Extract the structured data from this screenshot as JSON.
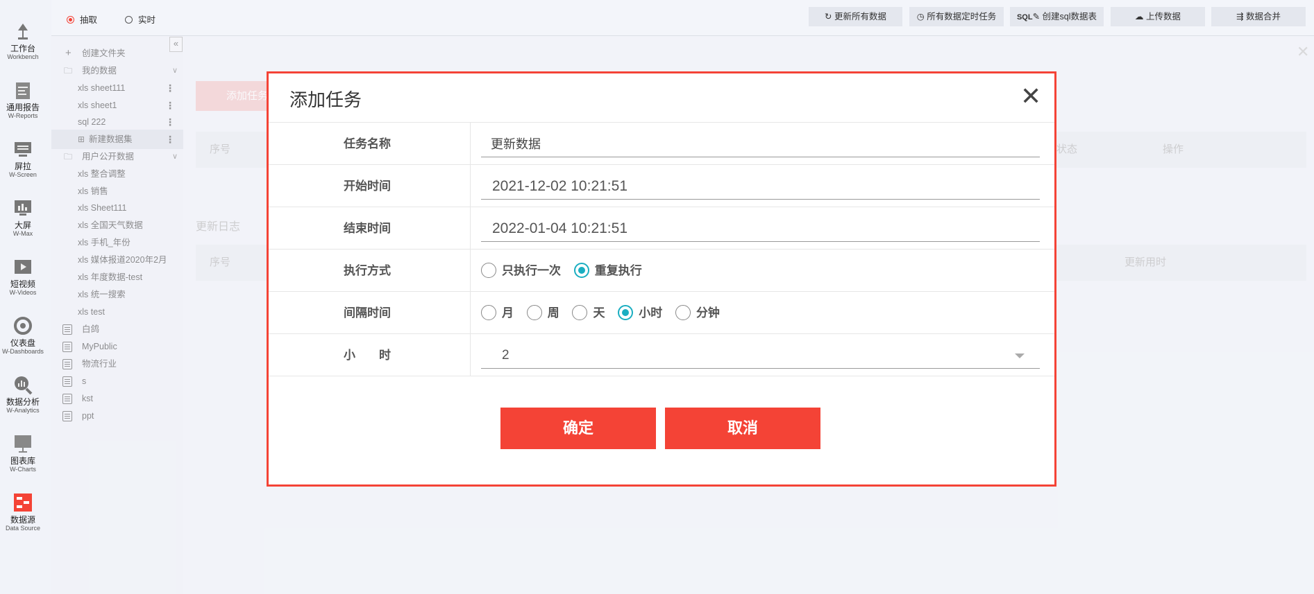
{
  "rail": [
    {
      "cn": "工作台",
      "en": "Workbench"
    },
    {
      "cn": "通用报告",
      "en": "W-Reports"
    },
    {
      "cn": "屏拉",
      "en": "W-Screen"
    },
    {
      "cn": "大屏",
      "en": "W-Max"
    },
    {
      "cn": "短视频",
      "en": "W-Videos"
    },
    {
      "cn": "仪表盘",
      "en": "W-Dashboards"
    },
    {
      "cn": "数据分析",
      "en": "W-Analytics"
    },
    {
      "cn": "图表库",
      "en": "W-Charts"
    },
    {
      "cn": "数据源",
      "en": "Data Source"
    }
  ],
  "mode": {
    "extract": "抽取",
    "realtime": "实时",
    "selected": "extract"
  },
  "toolbar": {
    "refresh_all": "更新所有数据",
    "schedule_all": "所有数据定时任务",
    "create_sql": "创建sql数据表",
    "upload": "上传数据",
    "merge": "数据合并",
    "sql_prefix": "SQL"
  },
  "sidebar": {
    "create_folder": "创建文件夹",
    "my_data": "我的数据",
    "my_items": [
      {
        "tag": "xls",
        "name": "sheet111"
      },
      {
        "tag": "xls",
        "name": "sheet1"
      },
      {
        "tag": "sql",
        "name": "222"
      },
      {
        "tag": "",
        "name": "新建数据集"
      }
    ],
    "public_data": "用户公开数据",
    "public_items": [
      {
        "tag": "xls",
        "name": "整合调整"
      },
      {
        "tag": "xls",
        "name": "销售"
      },
      {
        "tag": "xls",
        "name": "Sheet111"
      },
      {
        "tag": "xls",
        "name": "全国天气数据"
      },
      {
        "tag": "xls",
        "name": "手机_年份"
      },
      {
        "tag": "xls",
        "name": "媒体报道2020年2月"
      },
      {
        "tag": "xls",
        "name": "年度数据-test"
      },
      {
        "tag": "xls",
        "name": "统一搜索"
      },
      {
        "tag": "xls",
        "name": "test"
      }
    ],
    "other_items": [
      "白鸽",
      "MyPublic",
      "物流行业",
      "s",
      "kst",
      "ppt"
    ]
  },
  "background": {
    "add_task": "添加任务",
    "col_index": "序号",
    "col_status": "状态",
    "col_action": "操作",
    "log_title": "更新日志",
    "log_col_index": "序号",
    "log_col_duration": "更新用时"
  },
  "dialog": {
    "title": "添加任务",
    "task_name_label": "任务名称",
    "task_name_value": "更新数据",
    "start_label": "开始时间",
    "start_value": "2021-12-02 10:21:51",
    "end_label": "结束时间",
    "end_value": "2022-01-04 10:21:51",
    "exec_label": "执行方式",
    "exec_options": [
      "只执行一次",
      "重复执行"
    ],
    "exec_selected": 1,
    "interval_label": "间隔时间",
    "interval_options": [
      "月",
      "周",
      "天",
      "小时",
      "分钟"
    ],
    "interval_selected": 3,
    "hours_label": "小　　时",
    "hours_value": "2",
    "confirm": "确定",
    "cancel": "取消",
    "accent_color": "#f44336",
    "radio_color": "#1aaec1"
  }
}
